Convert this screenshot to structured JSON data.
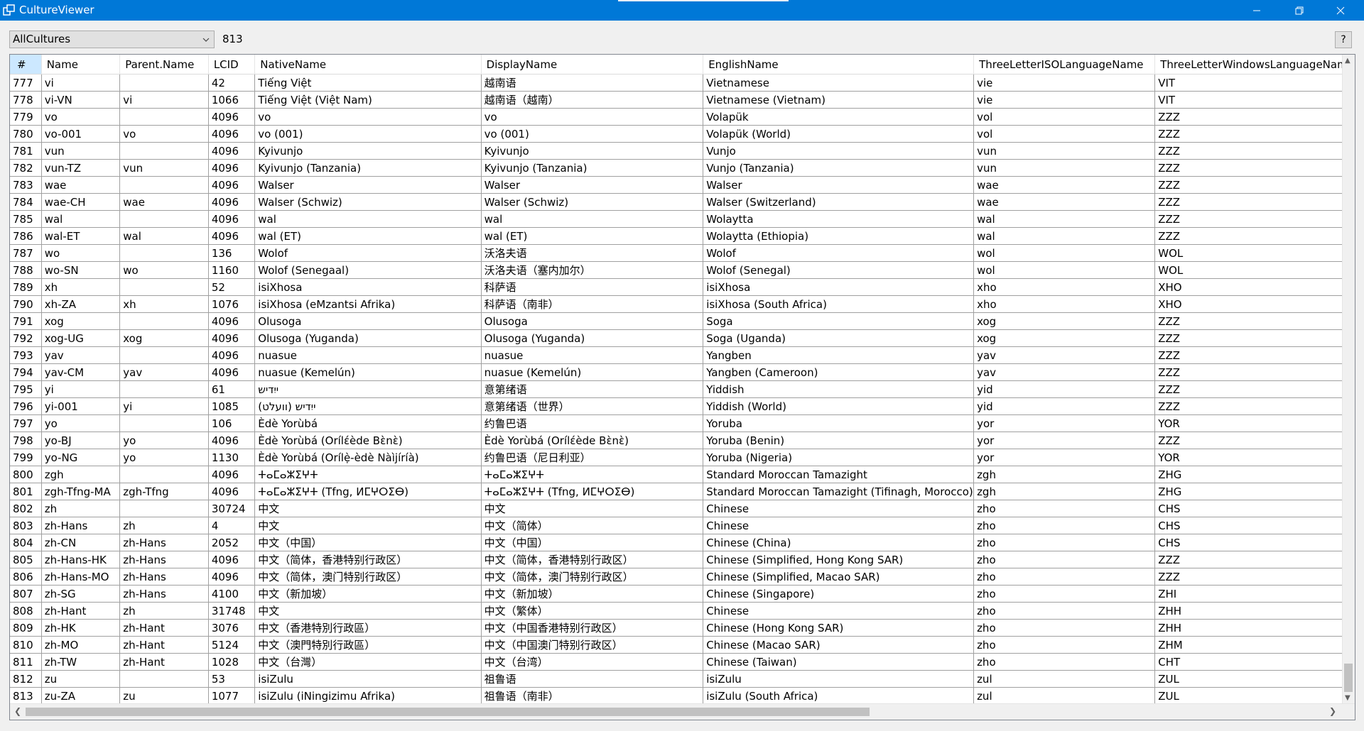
{
  "window": {
    "title": "CultureViewer"
  },
  "toolbar": {
    "filter_value": "AllCultures",
    "count": "813",
    "help_label": "?"
  },
  "columns": [
    "#",
    "Name",
    "Parent.Name",
    "LCID",
    "NativeName",
    "DisplayName",
    "EnglishName",
    "ThreeLetterISOLanguageName",
    "ThreeLetterWindowsLanguageName"
  ],
  "rows": [
    [
      "777",
      "vi",
      "",
      "42",
      "Tiếng Việt",
      "越南语",
      "Vietnamese",
      "vie",
      "VIT"
    ],
    [
      "778",
      "vi-VN",
      "vi",
      "1066",
      "Tiếng Việt (Việt Nam)",
      "越南语（越南）",
      "Vietnamese (Vietnam)",
      "vie",
      "VIT"
    ],
    [
      "779",
      "vo",
      "",
      "4096",
      "vo",
      "vo",
      "Volapük",
      "vol",
      "ZZZ"
    ],
    [
      "780",
      "vo-001",
      "vo",
      "4096",
      "vo (001)",
      "vo (001)",
      "Volapük (World)",
      "vol",
      "ZZZ"
    ],
    [
      "781",
      "vun",
      "",
      "4096",
      "Kyivunjo",
      "Kyivunjo",
      "Vunjo",
      "vun",
      "ZZZ"
    ],
    [
      "782",
      "vun-TZ",
      "vun",
      "4096",
      "Kyivunjo (Tanzania)",
      "Kyivunjo (Tanzania)",
      "Vunjo (Tanzania)",
      "vun",
      "ZZZ"
    ],
    [
      "783",
      "wae",
      "",
      "4096",
      "Walser",
      "Walser",
      "Walser",
      "wae",
      "ZZZ"
    ],
    [
      "784",
      "wae-CH",
      "wae",
      "4096",
      "Walser (Schwiz)",
      "Walser (Schwiz)",
      "Walser (Switzerland)",
      "wae",
      "ZZZ"
    ],
    [
      "785",
      "wal",
      "",
      "4096",
      "wal",
      "wal",
      "Wolaytta",
      "wal",
      "ZZZ"
    ],
    [
      "786",
      "wal-ET",
      "wal",
      "4096",
      "wal (ET)",
      "wal (ET)",
      "Wolaytta (Ethiopia)",
      "wal",
      "ZZZ"
    ],
    [
      "787",
      "wo",
      "",
      "136",
      "Wolof",
      "沃洛夫语",
      "Wolof",
      "wol",
      "WOL"
    ],
    [
      "788",
      "wo-SN",
      "wo",
      "1160",
      "Wolof (Senegaal)",
      "沃洛夫语（塞内加尔）",
      "Wolof (Senegal)",
      "wol",
      "WOL"
    ],
    [
      "789",
      "xh",
      "",
      "52",
      "isiXhosa",
      "科萨语",
      "isiXhosa",
      "xho",
      "XHO"
    ],
    [
      "790",
      "xh-ZA",
      "xh",
      "1076",
      "isiXhosa (eMzantsi Afrika)",
      "科萨语（南非）",
      "isiXhosa (South Africa)",
      "xho",
      "XHO"
    ],
    [
      "791",
      "xog",
      "",
      "4096",
      "Olusoga",
      "Olusoga",
      "Soga",
      "xog",
      "ZZZ"
    ],
    [
      "792",
      "xog-UG",
      "xog",
      "4096",
      "Olusoga (Yuganda)",
      "Olusoga (Yuganda)",
      "Soga (Uganda)",
      "xog",
      "ZZZ"
    ],
    [
      "793",
      "yav",
      "",
      "4096",
      "nuasue",
      "nuasue",
      "Yangben",
      "yav",
      "ZZZ"
    ],
    [
      "794",
      "yav-CM",
      "yav",
      "4096",
      "nuasue (Kemelún)",
      "nuasue (Kemelún)",
      "Yangben (Cameroon)",
      "yav",
      "ZZZ"
    ],
    [
      "795",
      "yi",
      "",
      "61",
      "ייִדיש",
      "意第绪语",
      "Yiddish",
      "yid",
      "ZZZ"
    ],
    [
      "796",
      "yi-001",
      "yi",
      "1085",
      "ייִדיש (וועלט)",
      "意第绪语（世界）",
      "Yiddish (World)",
      "yid",
      "ZZZ"
    ],
    [
      "797",
      "yo",
      "",
      "106",
      "Èdè Yorùbá",
      "约鲁巴语",
      "Yoruba",
      "yor",
      "YOR"
    ],
    [
      "798",
      "yo-BJ",
      "yo",
      "4096",
      "Èdè Yorùbá (Orílɛ́ède Bɛ̀nɛ̀)",
      "Èdè Yorùbá (Orílɛ́ède Bɛ̀nɛ̀)",
      "Yoruba (Benin)",
      "yor",
      "ZZZ"
    ],
    [
      "799",
      "yo-NG",
      "yo",
      "1130",
      "Èdè Yorùbá (Orílẹ̀-èdè Nàìjíríà)",
      "约鲁巴语（尼日利亚）",
      "Yoruba (Nigeria)",
      "yor",
      "YOR"
    ],
    [
      "800",
      "zgh",
      "",
      "4096",
      "ⵜⴰⵎⴰⵣⵉⵖⵜ",
      "ⵜⴰⵎⴰⵣⵉⵖⵜ",
      "Standard Moroccan Tamazight",
      "zgh",
      "ZHG"
    ],
    [
      "801",
      "zgh-Tfng-MA",
      "zgh-Tfng",
      "4096",
      "ⵜⴰⵎⴰⵣⵉⵖⵜ (Tfng, ⵍⵎⵖⵔⵉⴱ)",
      "ⵜⴰⵎⴰⵣⵉⵖⵜ (Tfng, ⵍⵎⵖⵔⵉⴱ)",
      "Standard Moroccan Tamazight (Tifinagh, Morocco)",
      "zgh",
      "ZHG"
    ],
    [
      "802",
      "zh",
      "",
      "30724",
      "中文",
      "中文",
      "Chinese",
      "zho",
      "CHS"
    ],
    [
      "803",
      "zh-Hans",
      "zh",
      "4",
      "中文",
      "中文（简体）",
      "Chinese",
      "zho",
      "CHS"
    ],
    [
      "804",
      "zh-CN",
      "zh-Hans",
      "2052",
      "中文（中国）",
      "中文（中国）",
      "Chinese (China)",
      "zho",
      "CHS"
    ],
    [
      "805",
      "zh-Hans-HK",
      "zh-Hans",
      "4096",
      "中文（简体，香港特别行政区）",
      "中文（简体，香港特别行政区）",
      "Chinese (Simplified, Hong Kong SAR)",
      "zho",
      "ZZZ"
    ],
    [
      "806",
      "zh-Hans-MO",
      "zh-Hans",
      "4096",
      "中文（简体，澳门特别行政区）",
      "中文（简体，澳门特别行政区）",
      "Chinese (Simplified, Macao SAR)",
      "zho",
      "ZZZ"
    ],
    [
      "807",
      "zh-SG",
      "zh-Hans",
      "4100",
      "中文（新加坡）",
      "中文（新加坡）",
      "Chinese (Singapore)",
      "zho",
      "ZHI"
    ],
    [
      "808",
      "zh-Hant",
      "zh",
      "31748",
      "中文",
      "中文（繁体）",
      "Chinese",
      "zho",
      "ZHH"
    ],
    [
      "809",
      "zh-HK",
      "zh-Hant",
      "3076",
      "中文（香港特別行政區）",
      "中文（中国香港特别行政区）",
      "Chinese (Hong Kong SAR)",
      "zho",
      "ZHH"
    ],
    [
      "810",
      "zh-MO",
      "zh-Hant",
      "5124",
      "中文（澳門特別行政區）",
      "中文（中国澳门特别行政区）",
      "Chinese (Macao SAR)",
      "zho",
      "ZHM"
    ],
    [
      "811",
      "zh-TW",
      "zh-Hant",
      "1028",
      "中文（台灣）",
      "中文（台湾）",
      "Chinese (Taiwan)",
      "zho",
      "CHT"
    ],
    [
      "812",
      "zu",
      "",
      "53",
      "isiZulu",
      "祖鲁语",
      "isiZulu",
      "zul",
      "ZUL"
    ],
    [
      "813",
      "zu-ZA",
      "zu",
      "1077",
      "isiZulu (iNingizimu Afrika)",
      "祖鲁语（南非）",
      "isiZulu (South Africa)",
      "zul",
      "ZUL"
    ]
  ]
}
